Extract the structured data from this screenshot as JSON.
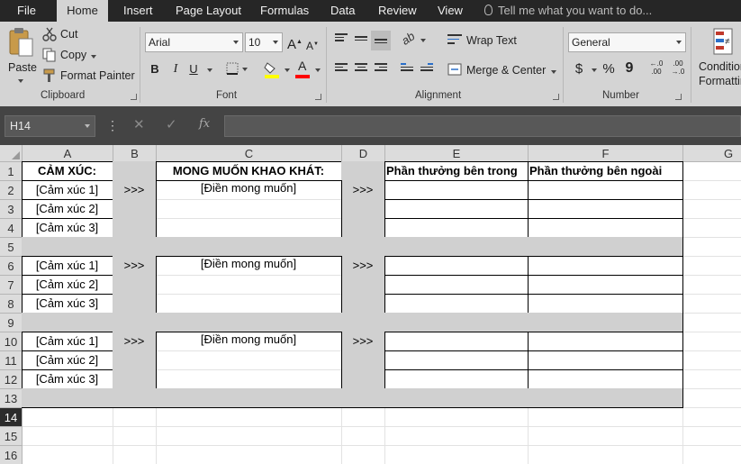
{
  "menu": {
    "tabs": [
      {
        "label": "File",
        "active": false
      },
      {
        "label": "Home",
        "active": true
      },
      {
        "label": "Insert",
        "active": false
      },
      {
        "label": "Page Layout",
        "active": false
      },
      {
        "label": "Formulas",
        "active": false
      },
      {
        "label": "Data",
        "active": false
      },
      {
        "label": "Review",
        "active": false
      },
      {
        "label": "View",
        "active": false
      }
    ],
    "tell_me": "Tell me what you want to do..."
  },
  "ribbon": {
    "clipboard": {
      "paste": "Paste",
      "cut": "Cut",
      "copy": "Copy",
      "format_painter": "Format Painter",
      "label": "Clipboard"
    },
    "font": {
      "name": "Arial",
      "size": "10",
      "bold": "B",
      "italic": "I",
      "underline": "U",
      "grow": "A",
      "shrink": "A",
      "font_color_letter": "A",
      "label": "Font"
    },
    "alignment": {
      "wrap_text": "Wrap Text",
      "merge_center": "Merge & Center",
      "label": "Alignment"
    },
    "number": {
      "format": "General",
      "currency": "$",
      "percent": "%",
      "comma": "9",
      "inc_decimal": "←.0 .00",
      "dec_decimal": ".00 →.0",
      "label": "Number"
    },
    "styles": {
      "conditional_line1": "Conditional",
      "conditional_line2": "Formatting"
    },
    "colors": {
      "highlight": "#ffff00",
      "font_color": "#ff0000"
    }
  },
  "formula_bar": {
    "name_box": "H14",
    "fx": "fx",
    "cancel": "✕",
    "enter": "✓",
    "value": ""
  },
  "sheet": {
    "columns": [
      "A",
      "B",
      "C",
      "D",
      "E",
      "F",
      "G"
    ],
    "rows": [
      "1",
      "2",
      "3",
      "4",
      "5",
      "6",
      "7",
      "8",
      "9",
      "10",
      "11",
      "12",
      "13",
      "14",
      "15",
      "16"
    ],
    "selected_row": "14",
    "headers": {
      "a1": "CẢM XÚC:",
      "c1": "MONG MUỐN KHAO KHÁT:",
      "e1": "Phần thưởng bên trong",
      "f1": "Phần thưởng bên ngoài"
    },
    "blocks": [
      {
        "emotions": [
          "[Cảm xúc 1]",
          "[Cảm xúc 2]",
          "[Cảm xúc 3]"
        ],
        "arrow_b": ">>>",
        "desire": "[Điền mong muốn]",
        "arrow_d": ">>>"
      },
      {
        "emotions": [
          "[Cảm xúc 1]",
          "[Cảm xúc 2]",
          "[Cảm xúc 3]"
        ],
        "arrow_b": ">>>",
        "desire": "[Điền mong muốn]",
        "arrow_d": ">>>"
      },
      {
        "emotions": [
          "[Cảm xúc 1]",
          "[Cảm xúc 2]",
          "[Cảm xúc 3]"
        ],
        "arrow_b": ">>>",
        "desire": "[Điền mong muốn]",
        "arrow_d": ">>>"
      }
    ],
    "fill_gray": "#d0d0d0"
  }
}
